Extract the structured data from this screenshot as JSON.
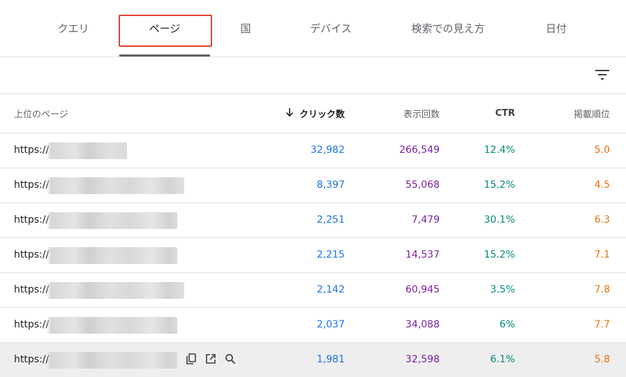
{
  "tabs": [
    {
      "label": "クエリ"
    },
    {
      "label": "ページ"
    },
    {
      "label": "国"
    },
    {
      "label": "デバイス"
    },
    {
      "label": "検索での見え方"
    },
    {
      "label": "日付"
    }
  ],
  "table": {
    "headers": {
      "page": "上位のページ",
      "clicks": "クリック数",
      "impressions": "表示回数",
      "ctr": "CTR",
      "position": "掲載順位"
    },
    "rows": [
      {
        "url": "https://",
        "clicks": "32,982",
        "impressions": "266,549",
        "ctr": "12.4%",
        "position": "5.0"
      },
      {
        "url": "https://",
        "clicks": "8,397",
        "impressions": "55,068",
        "ctr": "15.2%",
        "position": "4.5"
      },
      {
        "url": "https://",
        "clicks": "2,251",
        "impressions": "7,479",
        "ctr": "30.1%",
        "position": "6.3"
      },
      {
        "url": "https://",
        "clicks": "2,215",
        "impressions": "14,537",
        "ctr": "15.2%",
        "position": "7.1"
      },
      {
        "url": "https://",
        "clicks": "2,142",
        "impressions": "60,945",
        "ctr": "3.5%",
        "position": "7.8"
      },
      {
        "url": "https://",
        "clicks": "2,037",
        "impressions": "34,088",
        "ctr": "6%",
        "position": "7.7"
      },
      {
        "url": "https://",
        "clicks": "1,981",
        "impressions": "32,598",
        "ctr": "6.1%",
        "position": "5.8"
      }
    ]
  },
  "icons": {
    "filter": "filter-icon",
    "sort": "arrow-down-icon",
    "copy": "copy-icon",
    "open": "open-in-new-icon",
    "inspect": "search-icon"
  },
  "colors": {
    "clicks": "#1a73e8",
    "impressions": "#7b1fa2",
    "ctr": "#00897b",
    "position": "#e8710a",
    "highlight": "#e0432f"
  }
}
